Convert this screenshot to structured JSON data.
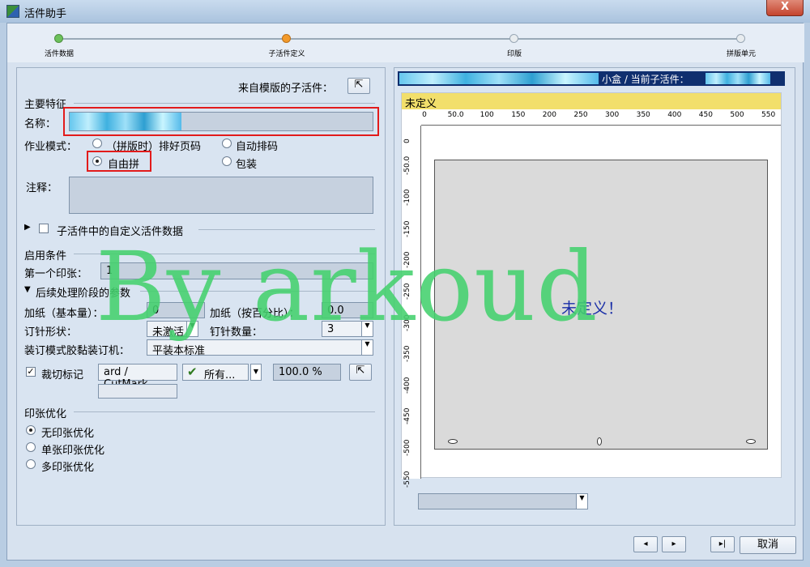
{
  "window": {
    "title": "活件助手",
    "close_glyph": "X"
  },
  "wizard": {
    "steps": [
      "活件数据",
      "子活件定义",
      "印版",
      "拼版单元"
    ]
  },
  "left": {
    "template_sub_label": "来自模版的子活件：",
    "main_features": "主要特征",
    "name_label": "名称：",
    "mode_label": "作业模式：",
    "mode_options": [
      "（拼版时）排好页码",
      "自动排码",
      "自由拼",
      "包装"
    ],
    "mode_selected": "自由拼",
    "comment_label": "注释：",
    "custom_data_label": "子活件中的自定义活件数据",
    "start_condition": "启用条件",
    "first_sheet_label": "第一个印张：",
    "first_sheet_value": "1",
    "post_section": "后续处理阶段的参数",
    "paper_base_label": "加纸（基本量）：",
    "paper_base_value": "0",
    "paper_pct_label": "加纸（按百分比）：",
    "paper_pct_value": "0.0",
    "staple_shape_label": "订针形状：",
    "staple_shape_value": "未激活",
    "staple_count_label": "钉针数量：",
    "staple_count_value": "3",
    "binding_label": "装订模式胶黏装订机：",
    "binding_value": "平装本标准",
    "cutmark_label": "裁切标记",
    "cutmark_value": "ard / CutMark",
    "cutmark_all": "所有...",
    "cutmark_pct": "100.0 %",
    "sheet_opt_section": "印张优化",
    "sheet_opt_options": [
      "无印张优化",
      "单张印张优化",
      "多印张优化"
    ],
    "sheet_opt_selected": "无印张优化"
  },
  "right": {
    "header_text": "小盒 / 当前子活件：",
    "undefined_bar": "未定义",
    "sheet_text": "未定义！",
    "ruler_x": [
      "0",
      "50.0",
      "100",
      "150",
      "200",
      "250",
      "300",
      "350",
      "400",
      "450",
      "500",
      "550"
    ],
    "ruler_y": [
      "0",
      "-50.0",
      "-100",
      "-150",
      "-200",
      "-250",
      "-300",
      "-350",
      "-400",
      "-450",
      "-500",
      "-550"
    ]
  },
  "footer": {
    "prev_glyph": "◂",
    "next_glyph": "▸",
    "last_glyph": "▸|",
    "cancel_label": "取消"
  },
  "watermark": "By arkoud",
  "colors": {
    "titlebar": "#b9cde3",
    "accent_red": "#e21b1b",
    "watermark_green": "#44d16e",
    "preview_header": "#0f2f6f"
  }
}
